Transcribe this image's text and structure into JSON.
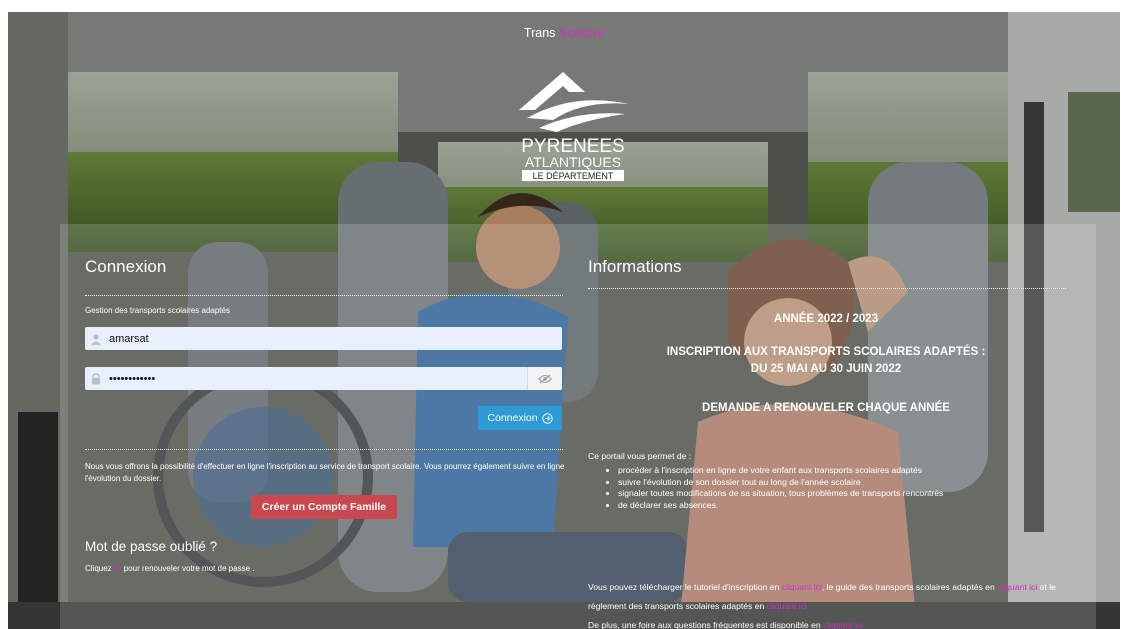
{
  "header": {
    "brand_part1": "Trans",
    "brand_part2": "Scolaire"
  },
  "logo": {
    "line1": "PYRENEES",
    "line2": "ATLANTIQUES",
    "line3": "LE DÉPARTEMENT"
  },
  "login": {
    "title": "Connexion",
    "subtitle": "Gestion des transports scolaires adaptés",
    "username_value": "amarsat",
    "password_value": "••••••••••••",
    "connect_label": "Connexion",
    "offer_text": "Nous vous offrons la possibilité d'effectuer en ligne l'inscription au service de transport scolaire. Vous pourrez également suivre en ligne l'évolution du dossier.",
    "create_label": "Créer un Compte Famille",
    "forgot_title": "Mot de passe oublié ?",
    "forgot_prefix": "Cliquez",
    "forgot_link": "ici",
    "forgot_suffix": "pour renouveler votre mot de passe ."
  },
  "info": {
    "title": "Informations",
    "year": "ANNÉE 2022 / 2023",
    "inscription_line1": "INSCRIPTION AUX TRANSPORTS SCOLAIRES ADAPTÉS :",
    "inscription_line2": "DU 25 MAI AU 30 JUIN 2022",
    "renew": "DEMANDE A RENOUVELER CHAQUE ANNÉE",
    "intro": "Ce portail vous permet de :",
    "bullets": [
      "procéder à l'inscription en ligne de votre enfant aux transports scolaires adaptés",
      "suivre l'évolution de son dossier tout au long de l'année scolaire",
      "signaler toutes modifications de sa situation, tous problèmes de transports rencontrés",
      "de déclarer ses absences."
    ],
    "dl_part1": "Vous pouvez télécharger le tutoriel d'inscription en",
    "dl_link1": "cliquant ici",
    "dl_part2": ", le guide des transports scolaires adaptés en",
    "dl_link2": "cliquant ici",
    "dl_part3": "et le règlement des transports scolaires adaptés en",
    "dl_link3": "cliquant ici",
    "faq_part1": "De plus, une foire aux questions fréquentes est disponible en",
    "faq_link": "cliquant ici"
  },
  "colors": {
    "accent_pink": "#d62dc9",
    "primary_blue": "#2e9bd7",
    "create_red": "#c9474f",
    "input_bg": "#e8f0fe"
  }
}
